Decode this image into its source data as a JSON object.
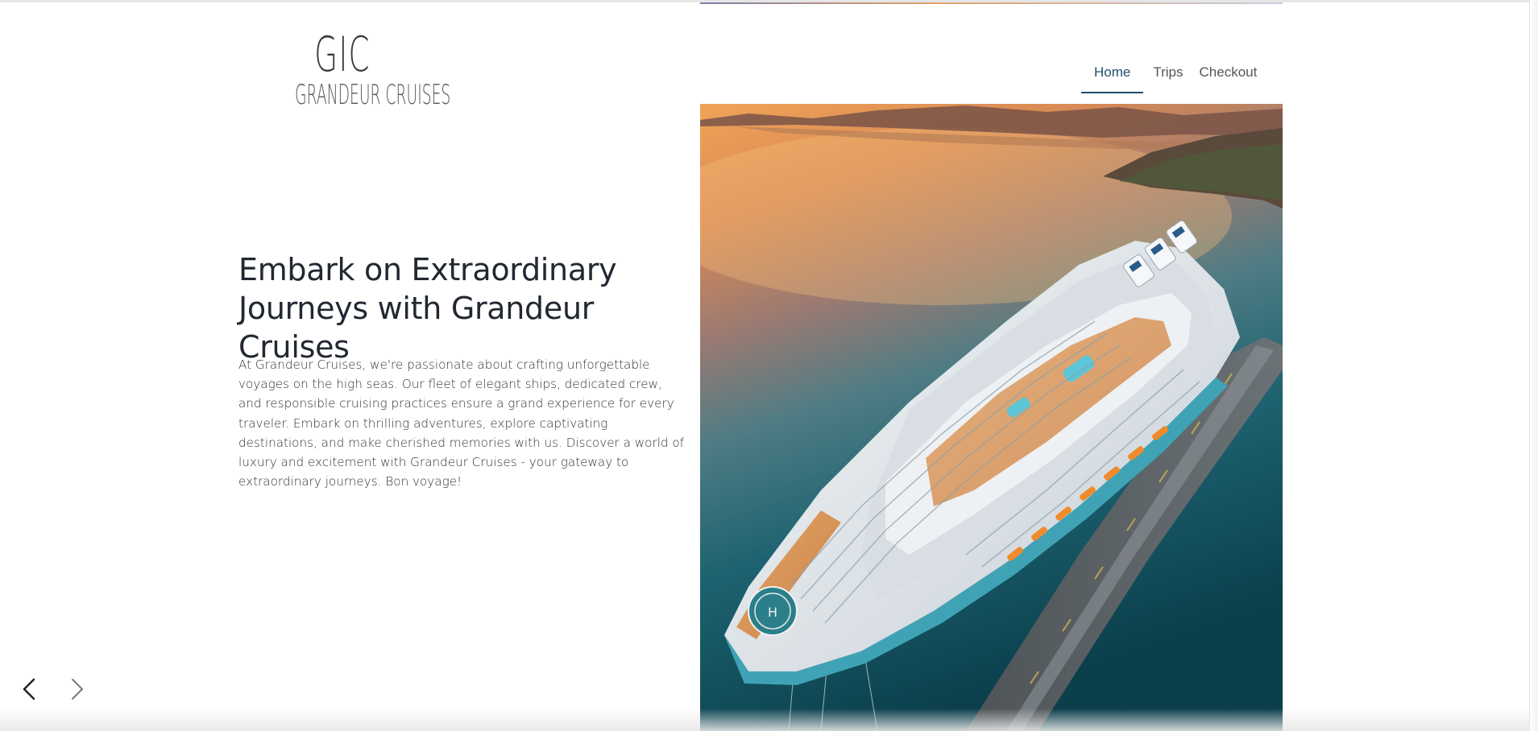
{
  "logo": {
    "mark": "GIC",
    "name": "GRANDEUR CRUISES"
  },
  "nav": {
    "items": [
      {
        "label": "Home",
        "active": true
      },
      {
        "label": "Trips",
        "active": false
      },
      {
        "label": "Checkout",
        "active": false
      }
    ]
  },
  "hero": {
    "title": "Embark on Extraordinary Journeys with Grandeur Cruises",
    "description": "At Grandeur Cruises, we're passionate about crafting unforgettable voyages on the high seas. Our fleet of elegant ships, dedicated crew, and responsible cruising practices ensure a grand experience for every traveler. Embark on thrilling adventures, explore captivating destinations, and make cherished memories with us. Discover a world of luxury and excitement with Grandeur Cruises - your gateway to extraordinary journeys. Bon voyage!",
    "image_icon": "cruise-ship-aerial-photo",
    "helipad_letter": "H"
  },
  "carousel": {
    "prev_icon": "chevron-left-icon",
    "next_icon": "chevron-right-icon"
  },
  "colors": {
    "accent": "#1f4e6a",
    "text": "#222831",
    "sea_deep": "#0e4a5a",
    "sunset": "#e8923f"
  }
}
